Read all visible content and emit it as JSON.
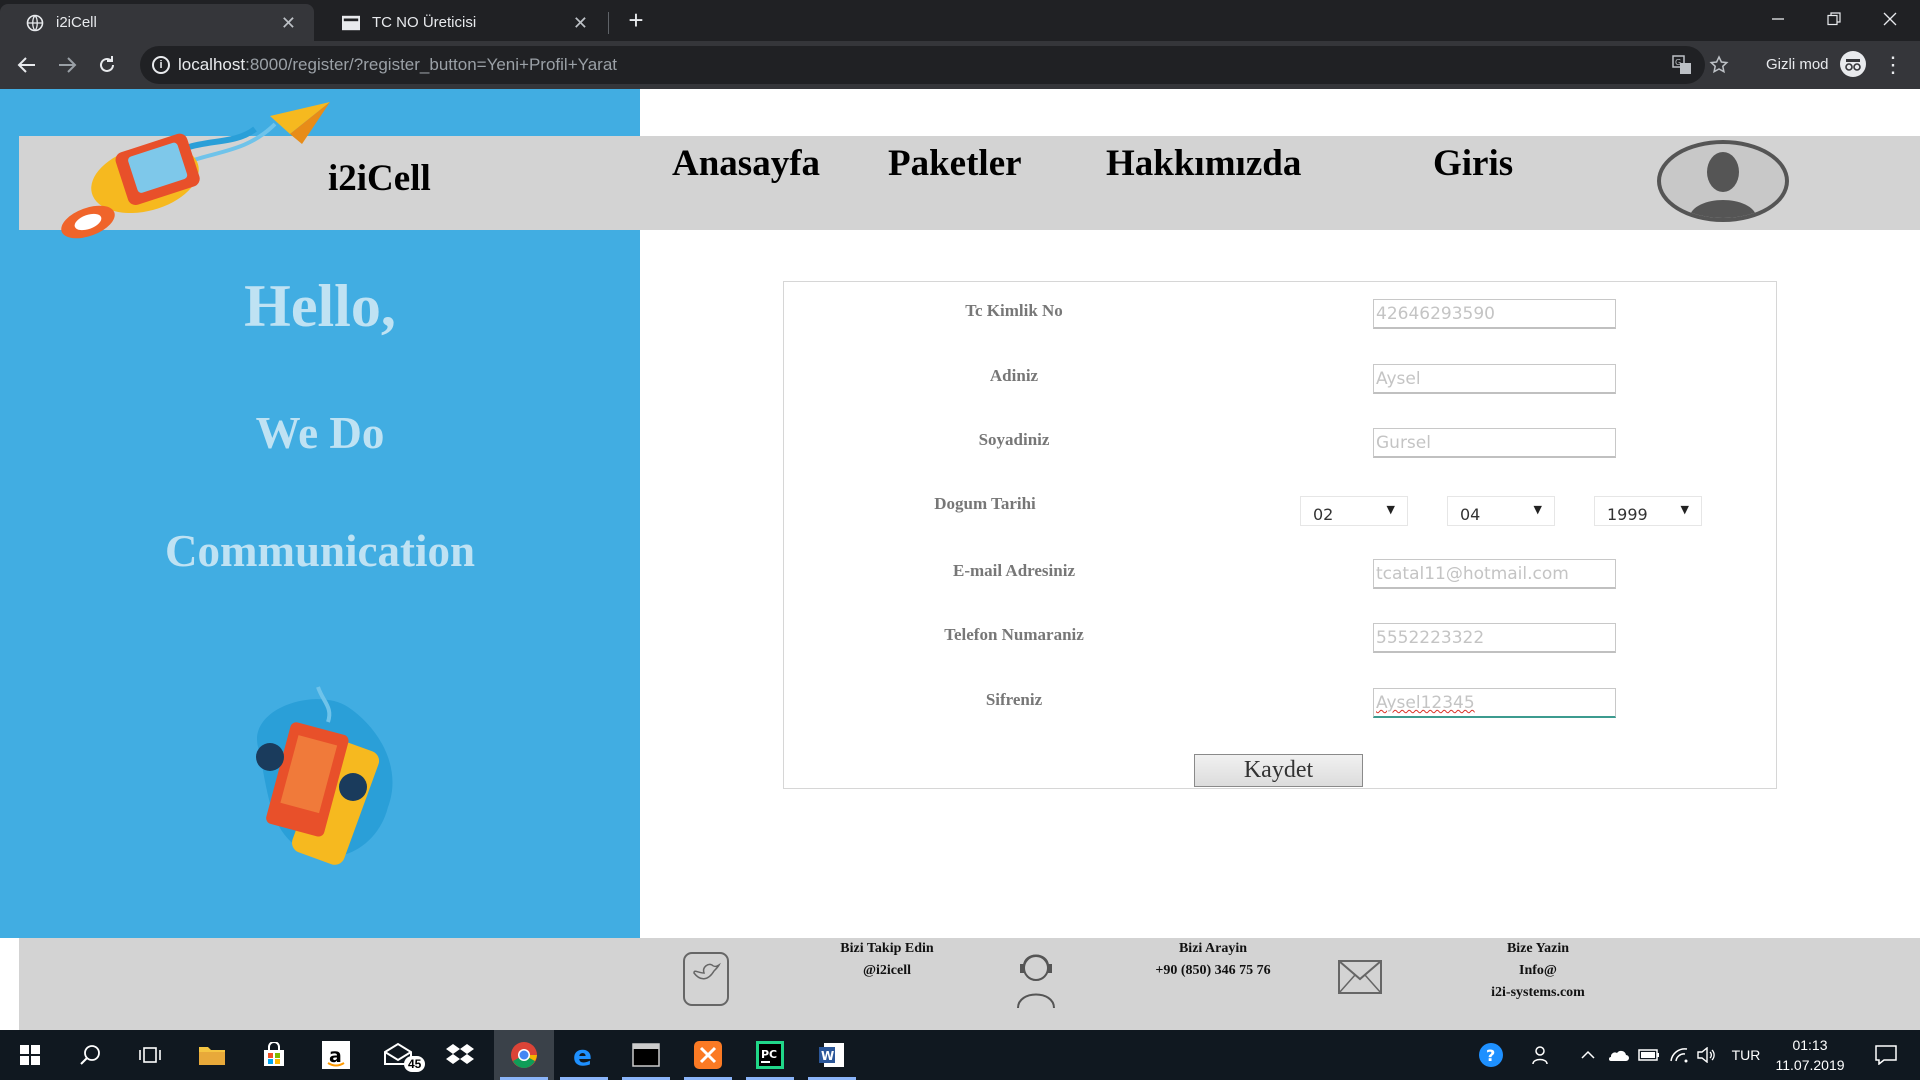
{
  "browser": {
    "tabs": [
      {
        "title": "i2iCell",
        "active": true
      },
      {
        "title": "TC NO Üreticisi",
        "active": false
      }
    ],
    "url_host": "localhost",
    "url_rest": ":8000/register/?register_button=Yeni+Profil+Yarat",
    "incognito_label": "Gizli mod"
  },
  "site": {
    "brand": "i2iCell",
    "nav": [
      "Anasayfa",
      "Paketler",
      "Hakkımızda",
      "Giris"
    ],
    "hero": {
      "line1": "Hello,",
      "line2": "We Do",
      "line3": "Communication"
    }
  },
  "form": {
    "fields": [
      {
        "label": "Tc Kimlik No",
        "value": "42646293590"
      },
      {
        "label": "Adiniz",
        "value": "Aysel"
      },
      {
        "label": "Soyadiniz",
        "value": "Gursel"
      },
      {
        "label": "E-mail Adresiniz",
        "value": "tcatal11@hotmail.com"
      },
      {
        "label": "Telefon Numaraniz",
        "value": "5552223322"
      },
      {
        "label": "Sifreniz",
        "value": "Aysel12345"
      }
    ],
    "dob_label": "Dogum Tarihi",
    "dob": {
      "day": "02",
      "month": "04",
      "year": "1999"
    },
    "save_label": "Kaydet"
  },
  "footer": {
    "follow": {
      "title": "Bizi Takip Edin",
      "handle": "@i2icell"
    },
    "call": {
      "title": "Bizi Arayin",
      "phone": "+90 (850) 346 75 76"
    },
    "write": {
      "title": "Bize Yazin",
      "line1": "Info@",
      "line2": "i2i-systems.com"
    }
  },
  "taskbar": {
    "mail_badge": "45",
    "lang": "TUR",
    "time": "01:13",
    "date": "11.07.2019"
  },
  "colors": {
    "left_panel": "#41ade2",
    "navbar": "#d3d3d3",
    "hero_text": "#bfe2f3"
  }
}
